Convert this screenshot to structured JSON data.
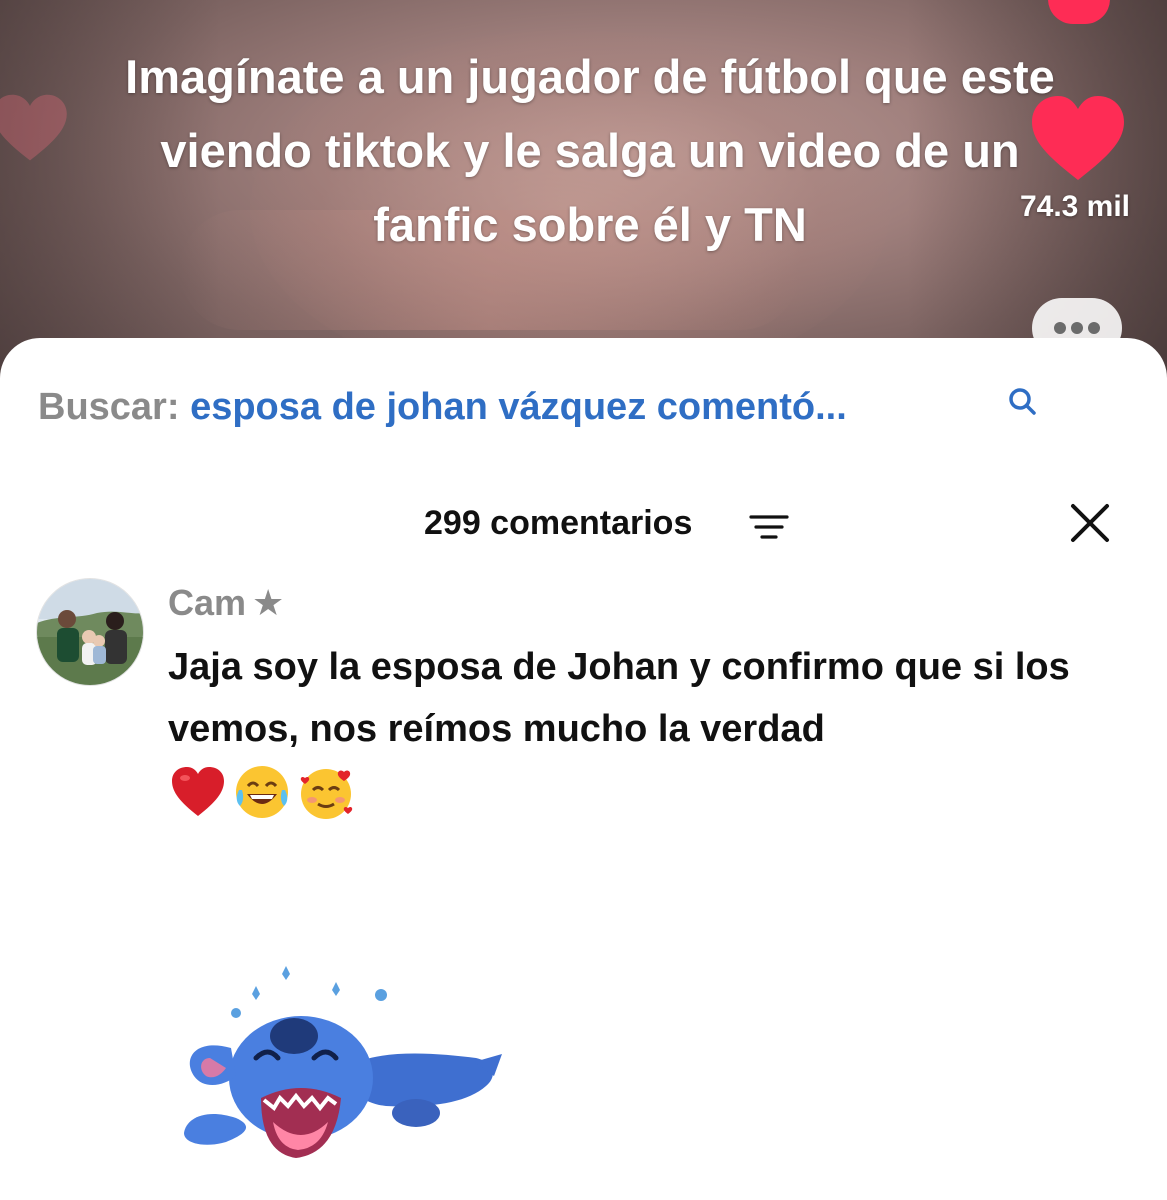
{
  "video": {
    "caption": "Imagínate a un jugador de fútbol que este viendo tiktok y le salga un video de un fanfic sobre él y TN",
    "like_count": "74.3 mil",
    "like_icon": "heart-icon",
    "more_icon": "more-dots-icon"
  },
  "search": {
    "label": "Buscar:",
    "query": "esposa de johan vázquez comentó...",
    "icon": "search-icon"
  },
  "comments_header": {
    "title": "299 comentarios",
    "filter_icon": "filter-icon",
    "close_icon": "close-icon"
  },
  "comment": {
    "username": "Cam",
    "badge": "★",
    "text": "Jaja soy la esposa de Johan y confirmo que si los vemos, nos reímos mucho la verdad",
    "emojis": [
      "heart-emoji",
      "laughing-emoji",
      "hearts-face-emoji"
    ],
    "sticker": "stitch-laughing-sticker"
  },
  "colors": {
    "accent_red": "#fe2c55",
    "link_blue": "#2f6ec4",
    "muted_gray": "#8a8a8a"
  }
}
